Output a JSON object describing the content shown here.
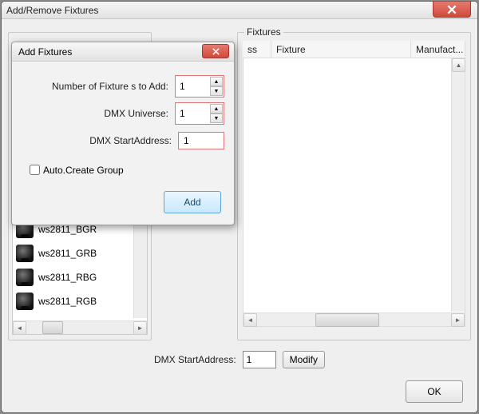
{
  "window": {
    "title": "Add/Remove Fixtures"
  },
  "dialog": {
    "title": "Add Fixtures",
    "labels": {
      "num_fixtures": "Number of Fixture s to Add:",
      "dmx_universe": "DMX Universe:",
      "dmx_start": "DMX StartAddress:",
      "auto_group": "Auto.Create Group",
      "add_button": "Add"
    },
    "values": {
      "num_fixtures": "1",
      "dmx_universe": "1",
      "dmx_start": "1"
    }
  },
  "fixtures_panel": {
    "title": "Fixtures",
    "columns": {
      "ss": "ss",
      "fixture": "Fixture",
      "manufacturer": "Manufact..."
    }
  },
  "bottom": {
    "label": "DMX StartAddress:",
    "value": "1",
    "modify": "Modify"
  },
  "ok_button": "OK",
  "fixture_list": [
    "ws2811_BGR",
    "ws2811_GRB",
    "ws2811_RBG",
    "ws2811_RGB"
  ]
}
